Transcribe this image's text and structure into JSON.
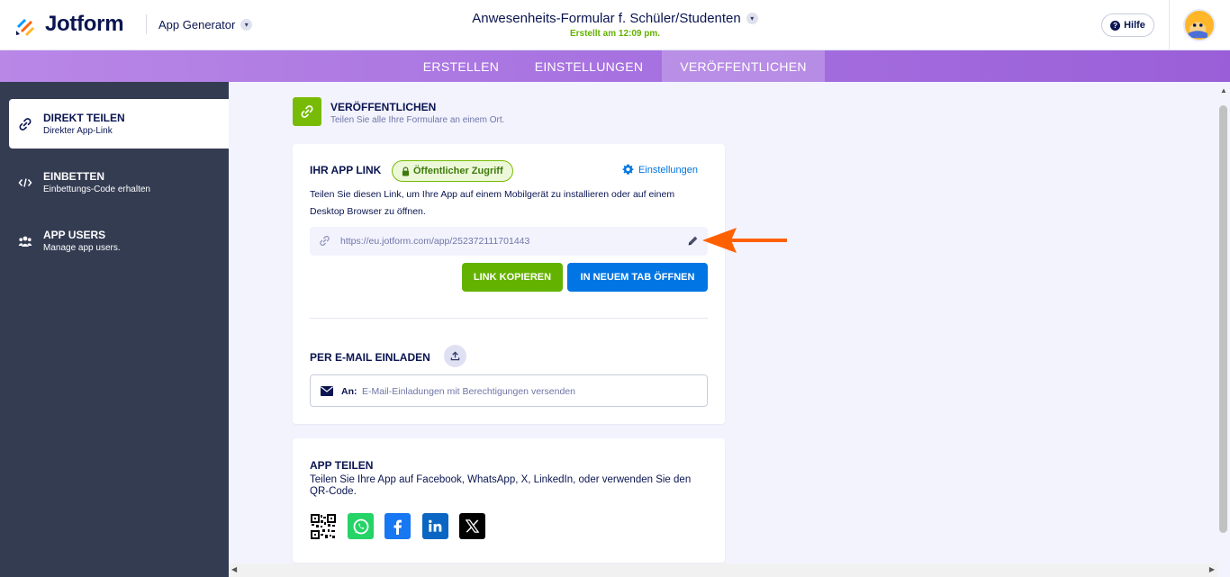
{
  "brand": {
    "name": "Jotform"
  },
  "header": {
    "product": "App Generator",
    "form_title": "Anwesenheits-Formular f. Schüler/Studenten",
    "created": "Erstellt am 12:09 pm.",
    "help": "Hilfe"
  },
  "tabs": [
    {
      "label": "ERSTELLEN"
    },
    {
      "label": "EINSTELLUNGEN"
    },
    {
      "label": "VERÖFFENTLICHEN"
    }
  ],
  "sidebar": {
    "items": [
      {
        "title": "DIREKT TEILEN",
        "desc": "Direkter App-Link",
        "icon": "link-icon",
        "active": true
      },
      {
        "title": "EINBETTEN",
        "desc": "Einbettungs-Code erhalten",
        "icon": "code-icon",
        "active": false
      },
      {
        "title": "APP USERS",
        "desc": "Manage app users.",
        "icon": "users-icon",
        "active": false
      }
    ]
  },
  "section": {
    "title": "VERÖFFENTLICHEN",
    "desc": "Teilen Sie alle Ihre Formulare an einem Ort."
  },
  "app_link": {
    "title": "IHR APP LINK",
    "access_badge": "Öffentlicher Zugriff",
    "settings": "Einstellungen",
    "desc": "Teilen Sie diesen Link, um Ihre App auf einem Mobilgerät zu installieren oder auf einem Desktop Browser zu öffnen.",
    "url": "https://eu.jotform.com/app/252372111701443",
    "copy_btn": "LINK KOPIEREN",
    "open_btn": "IN NEUEM TAB ÖFFNEN"
  },
  "email_invite": {
    "title": "PER E-MAIL EINLADEN",
    "to_label": "An:",
    "placeholder": "E-Mail-Einladungen mit Berechtigungen versenden"
  },
  "share": {
    "title": "APP TEILEN",
    "desc": "Teilen Sie Ihre App auf Facebook, WhatsApp, X, LinkedIn, oder verwenden Sie den QR-Code.",
    "icons": [
      "qr-code-icon",
      "whatsapp-icon",
      "facebook-icon",
      "linkedin-icon",
      "x-icon"
    ]
  },
  "colors": {
    "accent_green": "#64b200",
    "accent_blue": "#0075e3",
    "sidebar_bg": "#343c52",
    "tab_bar": "#a772e0",
    "arrow": "#ff6100"
  }
}
